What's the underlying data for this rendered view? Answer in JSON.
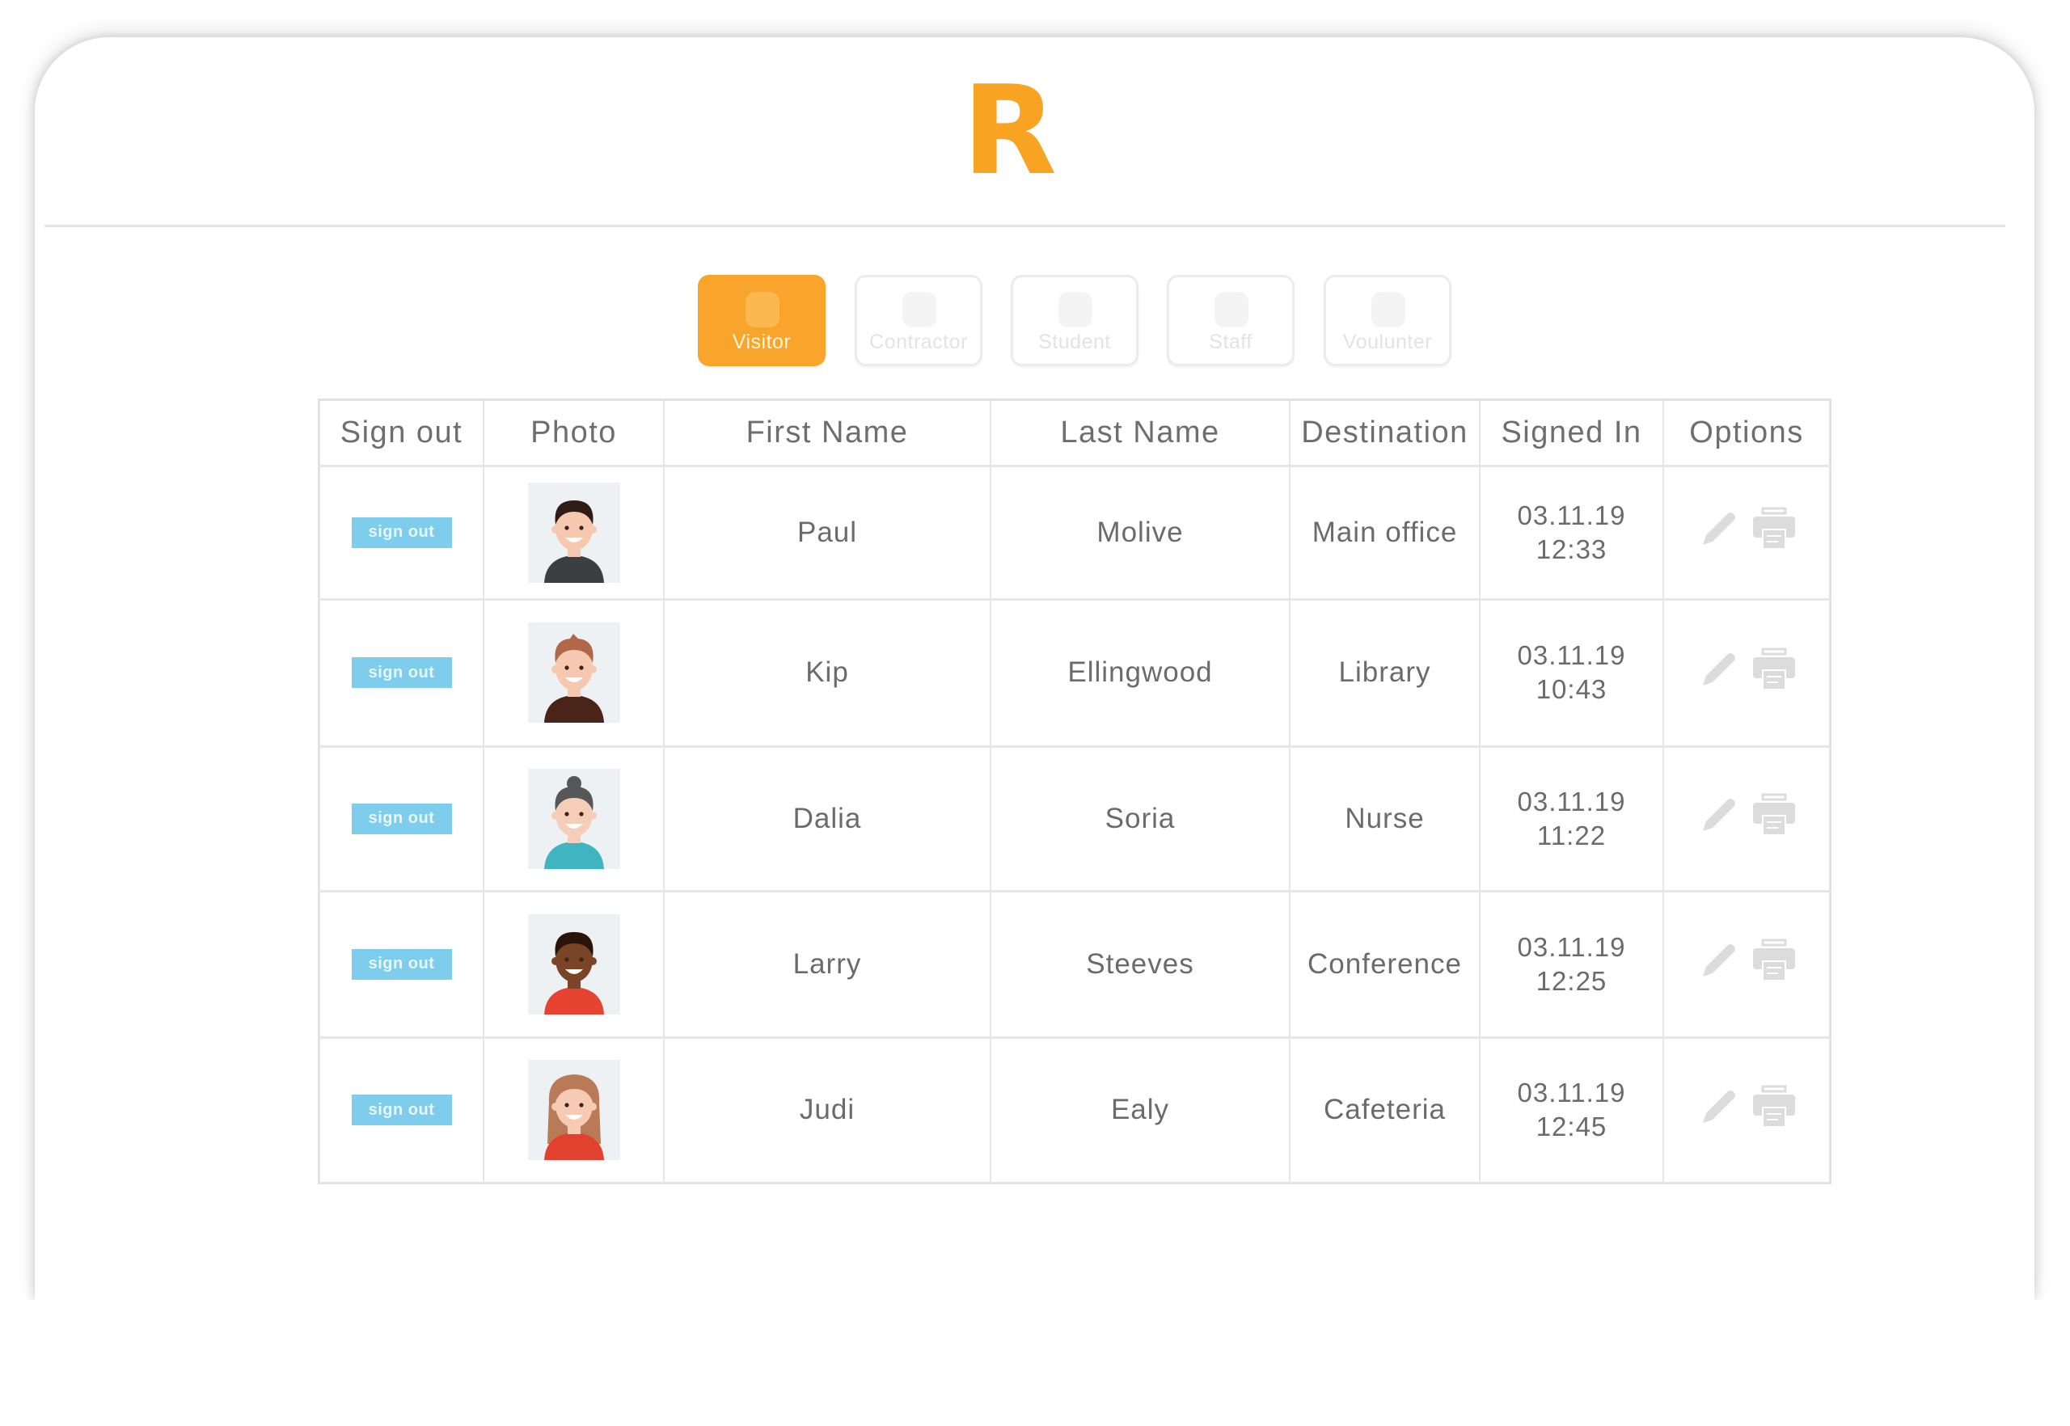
{
  "brand": {
    "logo_letter": "R",
    "accent": "#f9a322"
  },
  "type_tabs": [
    {
      "label": "Visitor",
      "active": true
    },
    {
      "label": "Contractor",
      "active": false
    },
    {
      "label": "Student",
      "active": false
    },
    {
      "label": "Staff",
      "active": false
    },
    {
      "label": "Voulunter",
      "active": false
    }
  ],
  "table": {
    "columns": [
      "Sign out",
      "Photo",
      "First Name",
      "Last Name",
      "Destination",
      "Signed In",
      "Options"
    ],
    "sign_out_label": "sign out",
    "sign_out_color": "#7ecdec",
    "rows": [
      {
        "first": "Paul",
        "last": "Molive",
        "destination": "Main office",
        "date": "03.11.19",
        "time": "12:33",
        "avatar": "man-dark-hair-grey-shirt"
      },
      {
        "first": "Kip",
        "last": "Ellingwood",
        "destination": "Library",
        "date": "03.11.19",
        "time": "10:43",
        "avatar": "man-red-hair-brown-shirt"
      },
      {
        "first": "Dalia",
        "last": "Soria",
        "destination": "Nurse",
        "date": "03.11.19",
        "time": "11:22",
        "avatar": "woman-grey-bun-teal-shirt"
      },
      {
        "first": "Larry",
        "last": "Steeves",
        "destination": "Conference",
        "date": "03.11.19",
        "time": "12:25",
        "avatar": "man-dark-skin-red-shirt"
      },
      {
        "first": "Judi",
        "last": "Ealy",
        "destination": "Cafeteria",
        "date": "03.11.19",
        "time": "12:45",
        "avatar": "woman-brown-hair-red-dress"
      }
    ],
    "option_icons": [
      "pencil-icon",
      "printer-icon"
    ]
  }
}
